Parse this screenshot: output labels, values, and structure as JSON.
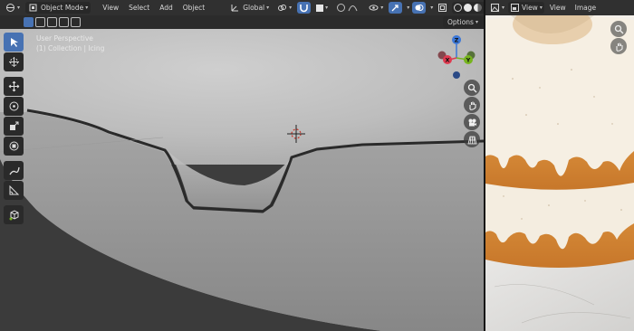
{
  "viewport_header": {
    "mode_label": "Object Mode",
    "menus": [
      "View",
      "Select",
      "Add",
      "Object"
    ],
    "orientation_label": "Global"
  },
  "viewport": {
    "perspective_label": "User Perspective",
    "collection_label": "(1) Collection | Icing",
    "options_label": "Options"
  },
  "gizmo": {
    "z": "Z",
    "y": "Y",
    "x": "X"
  },
  "image_editor": {
    "menus": [
      "View",
      "View",
      "Image"
    ]
  },
  "colors": {
    "accent": "#4772b3",
    "axis_x": "#e0394f",
    "axis_y": "#76b41e",
    "axis_z": "#3c78d8"
  }
}
